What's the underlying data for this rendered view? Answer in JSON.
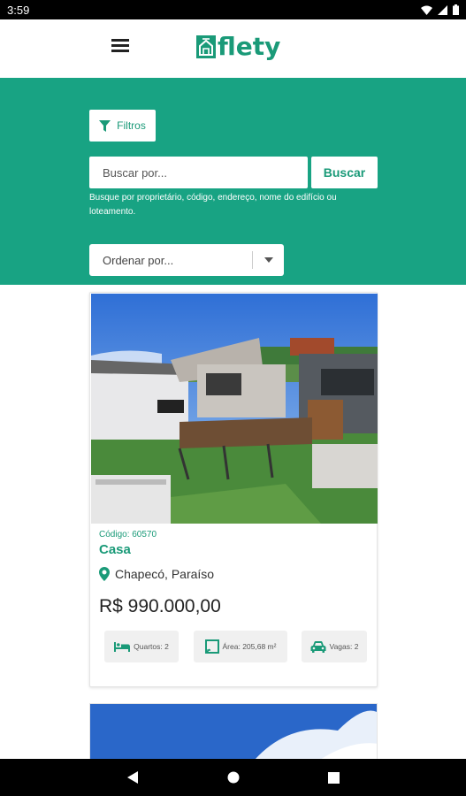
{
  "status": {
    "time": "3:59",
    "icons": [
      "wifi-icon",
      "signal-icon",
      "battery-icon"
    ]
  },
  "header": {
    "logo_text": "flety",
    "menu_icon": "hamburger-menu-icon"
  },
  "filters": {
    "label": "Filtros",
    "icon": "filter-icon"
  },
  "search": {
    "placeholder": "Buscar por...",
    "button_label": "Buscar",
    "hint": "Busque por proprietário, código, endereço, nome do edifício ou loteamento."
  },
  "sort": {
    "placeholder": "Ordenar por...",
    "icon": "chevron-down-icon"
  },
  "listing": {
    "code": "Código: 60570",
    "type": "Casa",
    "location": "Chapecó, Paraíso",
    "price": "R$ 990.000,00",
    "chips": {
      "bedrooms": "Quartos: 2",
      "area": "Área: 205,68 m²",
      "parking": "Vagas: 2"
    }
  },
  "colors": {
    "brand": "#18a383",
    "brand_text": "#1a9a78"
  },
  "system_nav": {
    "back": "back-icon",
    "home": "home-icon",
    "recents": "recents-icon"
  }
}
